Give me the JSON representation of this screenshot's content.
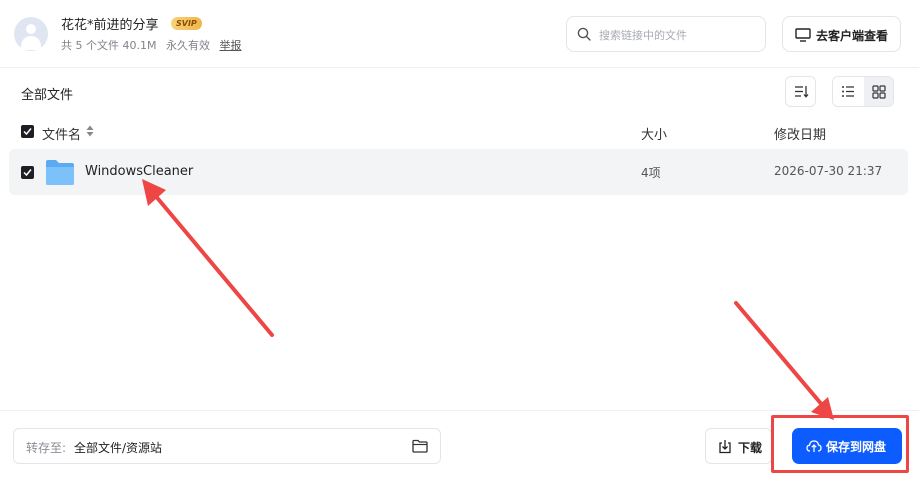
{
  "header": {
    "share_title": "花花*前进的分享",
    "badge": "SVIP",
    "file_count": "共 5 个文件 40.1M",
    "validity": "永久有效",
    "report": "举报"
  },
  "search": {
    "placeholder": "搜索链接中的文件"
  },
  "client_button": {
    "label": "去客户端查看"
  },
  "toolbar": {
    "all_files": "全部文件"
  },
  "table": {
    "columns": {
      "name": "文件名",
      "size": "大小",
      "modified": "修改日期"
    },
    "rows": [
      {
        "name": "WindowsCleaner",
        "size": "4项",
        "modified": "2026-07-30 21:37",
        "checked": true
      }
    ]
  },
  "footer": {
    "dest_label": "转存至:",
    "dest_path": "全部文件/资源站",
    "download": "下载",
    "save": "保存到网盘"
  },
  "colors": {
    "primary": "#0d5cff",
    "annotation": "#ee4545"
  }
}
